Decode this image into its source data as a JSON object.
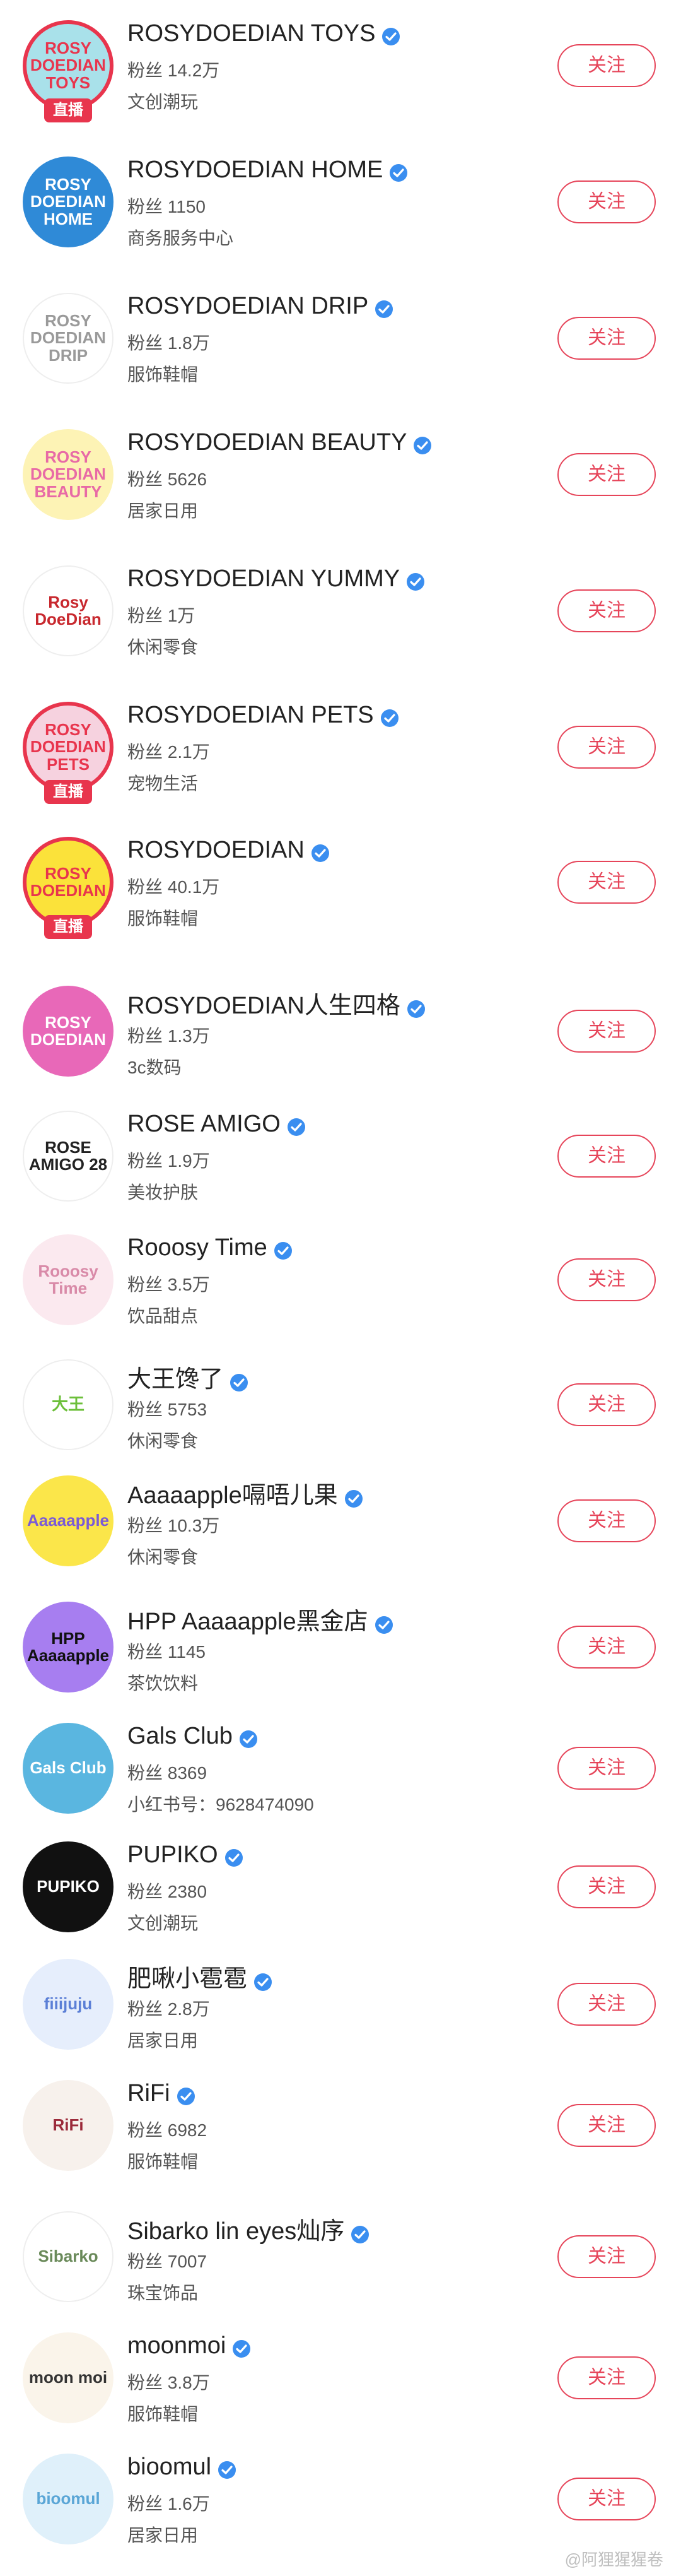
{
  "follow_label": "关注",
  "live_label": "直播",
  "watermark": "@阿狸猩猩卷",
  "accounts": [
    {
      "name": "ROSYDOEDIAN TOYS",
      "fans": "粉丝 14.2万",
      "category": "文创潮玩",
      "avatar_text": "ROSY DOEDIAN TOYS",
      "avatar_bg": "#a9e1ea",
      "avatar_fg": "#e8354d",
      "live": true
    },
    {
      "name": "ROSYDOEDIAN HOME",
      "fans": "粉丝 1150",
      "category": "商务服务中心",
      "avatar_text": "ROSY DOEDIAN HOME",
      "avatar_bg": "#2f8ad7",
      "avatar_fg": "#ffffff",
      "live": false
    },
    {
      "name": "ROSYDOEDIAN DRIP",
      "fans": "粉丝 1.8万",
      "category": "服饰鞋帽",
      "avatar_text": "ROSY DOEDIAN DRIP",
      "avatar_bg": "#ffffff",
      "avatar_fg": "#9a9a9a",
      "live": false
    },
    {
      "name": "ROSYDOEDIAN BEAUTY",
      "fans": "粉丝 5626",
      "category": "居家日用",
      "avatar_text": "ROSY DOEDIAN BEAUTY",
      "avatar_bg": "#fdf3b5",
      "avatar_fg": "#e86aa6",
      "live": false
    },
    {
      "name": "ROSYDOEDIAN YUMMY",
      "fans": "粉丝 1万",
      "category": "休闲零食",
      "avatar_text": "Rosy DoeDian",
      "avatar_bg": "#ffffff",
      "avatar_fg": "#c8282e",
      "live": false
    },
    {
      "name": "ROSYDOEDIAN PETS",
      "fans": "粉丝 2.1万",
      "category": "宠物生活",
      "avatar_text": "ROSY DOEDIAN PETS",
      "avatar_bg": "#f6d2df",
      "avatar_fg": "#e8354d",
      "live": true
    },
    {
      "name": "ROSYDOEDIAN",
      "fans": "粉丝 40.1万",
      "category": "服饰鞋帽",
      "avatar_text": "ROSY DOEDIAN",
      "avatar_bg": "#fbe23a",
      "avatar_fg": "#e8354d",
      "live": true
    },
    {
      "name": "ROSYDOEDIAN人生四格",
      "fans": "粉丝 1.3万",
      "category": "3c数码",
      "avatar_text": "ROSY DOEDIAN",
      "avatar_bg": "#e868b8",
      "avatar_fg": "#ffffff",
      "live": false
    },
    {
      "name": "ROSE AMIGO",
      "fans": "粉丝 1.9万",
      "category": "美妆护肤",
      "avatar_text": "ROSE AMIGO 28",
      "avatar_bg": "#ffffff",
      "avatar_fg": "#222222",
      "live": false
    },
    {
      "name": "Rooosy Time",
      "fans": "粉丝 3.5万",
      "category": "饮品甜点",
      "avatar_text": "Rooosy Time",
      "avatar_bg": "#fbe9ef",
      "avatar_fg": "#d98aa8",
      "live": false
    },
    {
      "name": "大王馋了",
      "fans": "粉丝 5753",
      "category": "休闲零食",
      "avatar_text": "大王",
      "avatar_bg": "#ffffff",
      "avatar_fg": "#6cbf3a",
      "live": false
    },
    {
      "name": "Aaaaapple嗝唔儿果",
      "fans": "粉丝 10.3万",
      "category": "休闲零食",
      "avatar_text": "Aaaaapple",
      "avatar_bg": "#fbe64a",
      "avatar_fg": "#7b5bd6",
      "live": false
    },
    {
      "name": "HPP Aaaaapple黑金店",
      "fans": "粉丝 1145",
      "category": "茶饮饮料",
      "avatar_text": "HPP Aaaaapple",
      "avatar_bg": "#a77ef0",
      "avatar_fg": "#111111",
      "live": false
    },
    {
      "name": "Gals Club",
      "fans": "粉丝 8369",
      "category": "小红书号：9628474090",
      "avatar_text": "Gals Club",
      "avatar_bg": "#5ab6e0",
      "avatar_fg": "#ffffff",
      "live": false
    },
    {
      "name": "PUPIKO",
      "fans": "粉丝 2380",
      "category": "文创潮玩",
      "avatar_text": "PUPIKO",
      "avatar_bg": "#111111",
      "avatar_fg": "#ffffff",
      "live": false
    },
    {
      "name": "肥啾小雹雹",
      "fans": "粉丝 2.8万",
      "category": "居家日用",
      "avatar_text": "fiiijuju",
      "avatar_bg": "#e6eefc",
      "avatar_fg": "#5b7fd6",
      "live": false
    },
    {
      "name": "RiFi",
      "fans": "粉丝 6982",
      "category": "服饰鞋帽",
      "avatar_text": "RiFi",
      "avatar_bg": "#f7f1ec",
      "avatar_fg": "#9b2a3a",
      "live": false
    },
    {
      "name": "Sibarko lin eyes灿序",
      "fans": "粉丝 7007",
      "category": "珠宝饰品",
      "avatar_text": "Sibarko",
      "avatar_bg": "#ffffff",
      "avatar_fg": "#6a8a5a",
      "live": false
    },
    {
      "name": "moonmoi",
      "fans": "粉丝 3.8万",
      "category": "服饰鞋帽",
      "avatar_text": "moon moi",
      "avatar_bg": "#faf4ea",
      "avatar_fg": "#333333",
      "live": false
    },
    {
      "name": "bioomul",
      "fans": "粉丝 1.6万",
      "category": "居家日用",
      "avatar_text": "bioomul",
      "avatar_bg": "#dff0fa",
      "avatar_fg": "#5aa6d6",
      "live": false
    }
  ]
}
